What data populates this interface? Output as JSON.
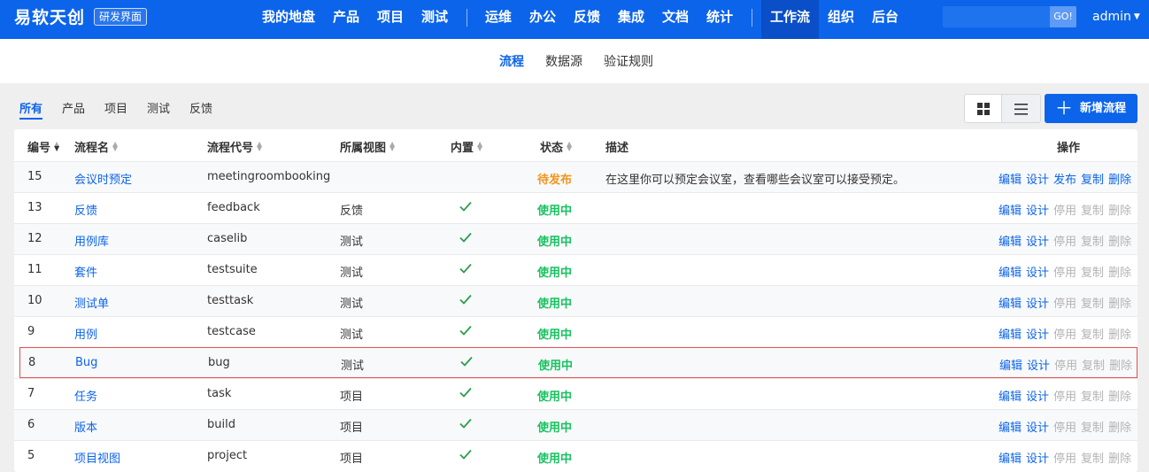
{
  "header": {
    "brand": "易软天创",
    "badge": "研发界面",
    "nav": [
      "我的地盘",
      "产品",
      "项目",
      "测试",
      "运维",
      "办公",
      "反馈",
      "集成",
      "文档",
      "统计",
      "工作流",
      "组织",
      "后台"
    ],
    "search": {
      "button": "GO!",
      "value": ""
    },
    "user": "admin"
  },
  "subnav": [
    "流程",
    "数据源",
    "验证规则"
  ],
  "filters": [
    "所有",
    "产品",
    "项目",
    "测试",
    "反馈"
  ],
  "toolbar": {
    "add_label": "新增流程"
  },
  "table": {
    "headers": {
      "id": "编号",
      "name": "流程名",
      "code": "流程代号",
      "view": "所属视图",
      "builtin": "内置",
      "status": "状态",
      "desc": "描述",
      "ops": "操作"
    },
    "rows": [
      {
        "id": "15",
        "name": "会议时预定",
        "code": "meetingroombooking",
        "view": "",
        "builtin": false,
        "status": "待发布",
        "desc": "在这里你可以预定会议室，查看哪些会议室可以接受预定。",
        "ops": [
          "编辑",
          "设计",
          "发布",
          "复制",
          "删除"
        ],
        "ops_enabled": [
          true,
          true,
          true,
          true,
          true
        ]
      },
      {
        "id": "13",
        "name": "反馈",
        "code": "feedback",
        "view": "反馈",
        "builtin": true,
        "status": "使用中",
        "desc": "",
        "ops": [
          "编辑",
          "设计",
          "停用",
          "复制",
          "删除"
        ],
        "ops_enabled": [
          true,
          true,
          false,
          false,
          false
        ]
      },
      {
        "id": "12",
        "name": "用例库",
        "code": "caselib",
        "view": "测试",
        "builtin": true,
        "status": "使用中",
        "desc": "",
        "ops": [
          "编辑",
          "设计",
          "停用",
          "复制",
          "删除"
        ],
        "ops_enabled": [
          true,
          true,
          false,
          false,
          false
        ]
      },
      {
        "id": "11",
        "name": "套件",
        "code": "testsuite",
        "view": "测试",
        "builtin": true,
        "status": "使用中",
        "desc": "",
        "ops": [
          "编辑",
          "设计",
          "停用",
          "复制",
          "删除"
        ],
        "ops_enabled": [
          true,
          true,
          false,
          false,
          false
        ]
      },
      {
        "id": "10",
        "name": "测试单",
        "code": "testtask",
        "view": "测试",
        "builtin": true,
        "status": "使用中",
        "desc": "",
        "ops": [
          "编辑",
          "设计",
          "停用",
          "复制",
          "删除"
        ],
        "ops_enabled": [
          true,
          true,
          false,
          false,
          false
        ]
      },
      {
        "id": "9",
        "name": "用例",
        "code": "testcase",
        "view": "测试",
        "builtin": true,
        "status": "使用中",
        "desc": "",
        "ops": [
          "编辑",
          "设计",
          "停用",
          "复制",
          "删除"
        ],
        "ops_enabled": [
          true,
          true,
          false,
          false,
          false
        ]
      },
      {
        "id": "8",
        "name": "Bug",
        "code": "bug",
        "view": "测试",
        "builtin": true,
        "status": "使用中",
        "desc": "",
        "ops": [
          "编辑",
          "设计",
          "停用",
          "复制",
          "删除"
        ],
        "ops_enabled": [
          true,
          true,
          false,
          false,
          false
        ]
      },
      {
        "id": "7",
        "name": "任务",
        "code": "task",
        "view": "项目",
        "builtin": true,
        "status": "使用中",
        "desc": "",
        "ops": [
          "编辑",
          "设计",
          "停用",
          "复制",
          "删除"
        ],
        "ops_enabled": [
          true,
          true,
          false,
          false,
          false
        ]
      },
      {
        "id": "6",
        "name": "版本",
        "code": "build",
        "view": "项目",
        "builtin": true,
        "status": "使用中",
        "desc": "",
        "ops": [
          "编辑",
          "设计",
          "停用",
          "复制",
          "删除"
        ],
        "ops_enabled": [
          true,
          true,
          false,
          false,
          false
        ]
      },
      {
        "id": "5",
        "name": "项目视图",
        "code": "project",
        "view": "项目",
        "builtin": true,
        "status": "使用中",
        "desc": "",
        "ops": [
          "编辑",
          "设计",
          "停用",
          "复制",
          "删除"
        ],
        "ops_enabled": [
          true,
          true,
          false,
          false,
          false
        ]
      }
    ]
  }
}
